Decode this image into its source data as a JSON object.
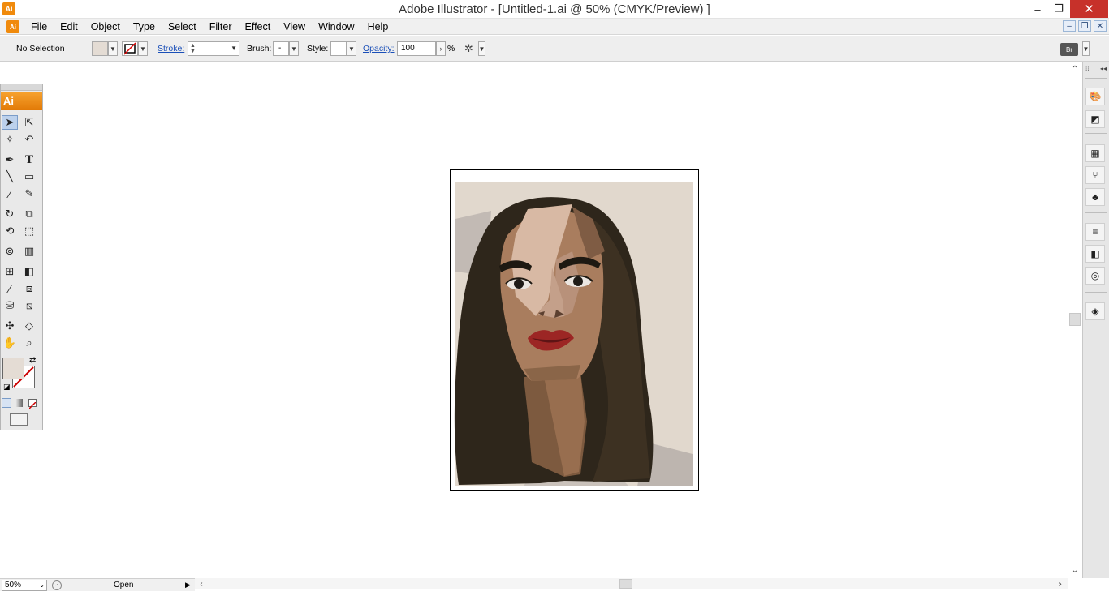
{
  "window": {
    "title": "Adobe Illustrator - [Untitled-1.ai @ 50% (CMYK/Preview) ]",
    "app_icon": "Ai",
    "min": "–",
    "max": "❐",
    "close": "✕"
  },
  "menu": {
    "items": [
      "File",
      "Edit",
      "Object",
      "Type",
      "Select",
      "Filter",
      "Effect",
      "View",
      "Window",
      "Help"
    ]
  },
  "control": {
    "selection": "No Selection",
    "stroke_label": "Stroke:",
    "brush_label": "Brush:",
    "brush_value": "-",
    "style_label": "Style:",
    "opacity_label": "Opacity:",
    "opacity_value": "100",
    "percent": "%"
  },
  "tools": {
    "logo": "Ai"
  },
  "status": {
    "zoom": "50%",
    "text": "Open"
  },
  "colors": {
    "fill_swatch": "#e4dcd4",
    "accent_orange": "#f08a0c",
    "hair": "#2e261b",
    "skin": "#a97d5e",
    "lips": "#9c2624",
    "background": "#ded6cc"
  }
}
